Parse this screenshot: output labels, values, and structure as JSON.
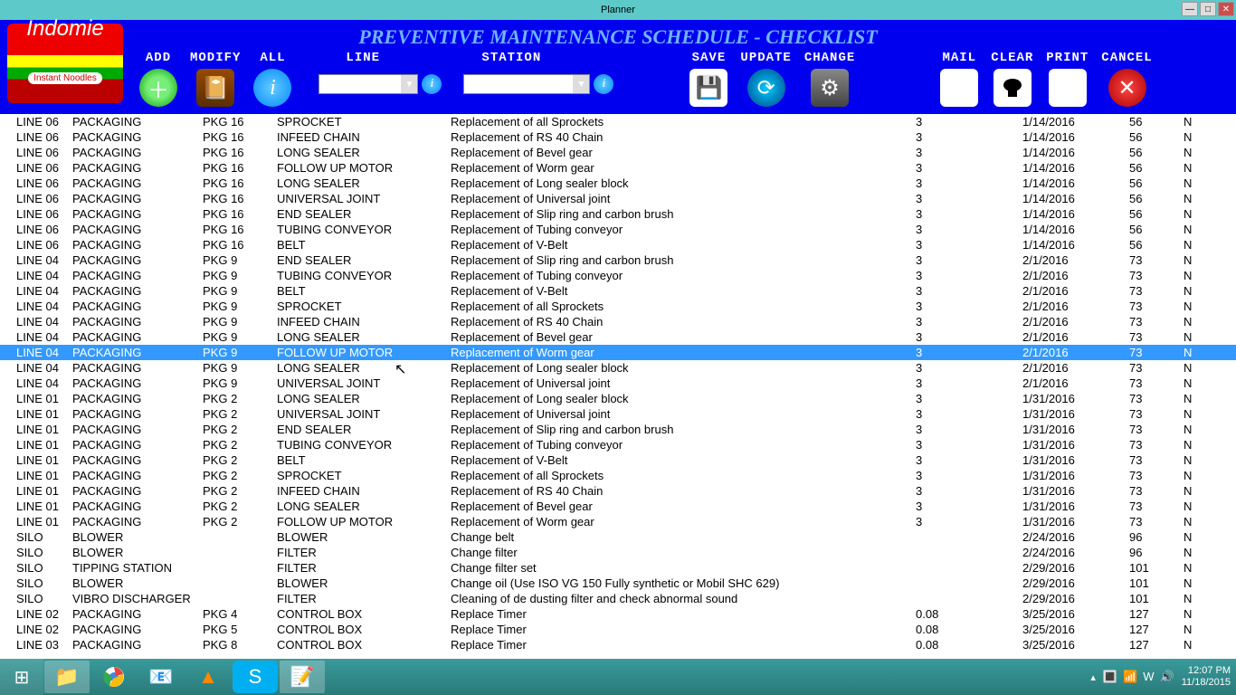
{
  "window": {
    "title": "Planner"
  },
  "toolbar": {
    "title": "PREVENTIVE MAINTENANCE SCHEDULE - CHECKLIST",
    "logo_text": "Indomie",
    "logo_sub": "Instant Noodles",
    "add": "ADD",
    "modify": "MODIFY",
    "all": "ALL",
    "line": "LINE",
    "station": "STATION",
    "save": "SAVE",
    "update": "UPDATE",
    "change": "CHANGE",
    "mail": "MAIL",
    "clear": "CLEAR",
    "print": "PRINT",
    "cancel": "CANCEL"
  },
  "selected_index": 15,
  "rows": [
    {
      "line": "LINE 06",
      "station": "PACKAGING",
      "code": "PKG 16",
      "part": "SPROCKET",
      "desc": "Replacement of all Sprockets",
      "qty": "3",
      "date": "1/14/2016",
      "days": "56",
      "flag": "N"
    },
    {
      "line": "LINE 06",
      "station": "PACKAGING",
      "code": "PKG 16",
      "part": "INFEED CHAIN",
      "desc": "Replacement of RS 40 Chain",
      "qty": "3",
      "date": "1/14/2016",
      "days": "56",
      "flag": "N"
    },
    {
      "line": "LINE 06",
      "station": "PACKAGING",
      "code": "PKG 16",
      "part": "LONG SEALER",
      "desc": "Replacement of Bevel gear",
      "qty": "3",
      "date": "1/14/2016",
      "days": "56",
      "flag": "N"
    },
    {
      "line": "LINE 06",
      "station": "PACKAGING",
      "code": "PKG 16",
      "part": "FOLLOW UP MOTOR",
      "desc": "Replacement of Worm gear",
      "qty": "3",
      "date": "1/14/2016",
      "days": "56",
      "flag": "N"
    },
    {
      "line": "LINE 06",
      "station": "PACKAGING",
      "code": "PKG 16",
      "part": "LONG SEALER",
      "desc": "Replacement of Long sealer block",
      "qty": "3",
      "date": "1/14/2016",
      "days": "56",
      "flag": "N"
    },
    {
      "line": "LINE 06",
      "station": "PACKAGING",
      "code": "PKG 16",
      "part": "UNIVERSAL JOINT",
      "desc": "Replacement of Universal joint",
      "qty": "3",
      "date": "1/14/2016",
      "days": "56",
      "flag": "N"
    },
    {
      "line": "LINE 06",
      "station": "PACKAGING",
      "code": "PKG 16",
      "part": "END SEALER",
      "desc": "Replacement of Slip ring and carbon brush",
      "qty": "3",
      "date": "1/14/2016",
      "days": "56",
      "flag": "N"
    },
    {
      "line": "LINE 06",
      "station": "PACKAGING",
      "code": "PKG 16",
      "part": "TUBING CONVEYOR",
      "desc": "Replacement of Tubing conveyor",
      "qty": "3",
      "date": "1/14/2016",
      "days": "56",
      "flag": "N"
    },
    {
      "line": "LINE 06",
      "station": "PACKAGING",
      "code": "PKG 16",
      "part": "BELT",
      "desc": "Replacement of V-Belt",
      "qty": "3",
      "date": "1/14/2016",
      "days": "56",
      "flag": "N"
    },
    {
      "line": "LINE 04",
      "station": "PACKAGING",
      "code": "PKG 9",
      "part": "END SEALER",
      "desc": "Replacement of Slip ring and carbon brush",
      "qty": "3",
      "date": "2/1/2016",
      "days": "73",
      "flag": "N"
    },
    {
      "line": "LINE 04",
      "station": "PACKAGING",
      "code": "PKG 9",
      "part": "TUBING CONVEYOR",
      "desc": "Replacement of Tubing conveyor",
      "qty": "3",
      "date": "2/1/2016",
      "days": "73",
      "flag": "N"
    },
    {
      "line": "LINE 04",
      "station": "PACKAGING",
      "code": "PKG 9",
      "part": "BELT",
      "desc": "Replacement of V-Belt",
      "qty": "3",
      "date": "2/1/2016",
      "days": "73",
      "flag": "N"
    },
    {
      "line": "LINE 04",
      "station": "PACKAGING",
      "code": "PKG 9",
      "part": "SPROCKET",
      "desc": "Replacement of all Sprockets",
      "qty": "3",
      "date": "2/1/2016",
      "days": "73",
      "flag": "N"
    },
    {
      "line": "LINE 04",
      "station": "PACKAGING",
      "code": "PKG 9",
      "part": "INFEED CHAIN",
      "desc": "Replacement of RS 40 Chain",
      "qty": "3",
      "date": "2/1/2016",
      "days": "73",
      "flag": "N"
    },
    {
      "line": "LINE 04",
      "station": "PACKAGING",
      "code": "PKG 9",
      "part": "LONG SEALER",
      "desc": "Replacement of Bevel gear",
      "qty": "3",
      "date": "2/1/2016",
      "days": "73",
      "flag": "N"
    },
    {
      "line": "LINE 04",
      "station": "PACKAGING",
      "code": "PKG 9",
      "part": "FOLLOW UP MOTOR",
      "desc": "Replacement of Worm gear",
      "qty": "3",
      "date": "2/1/2016",
      "days": "73",
      "flag": "N"
    },
    {
      "line": "LINE 04",
      "station": "PACKAGING",
      "code": "PKG 9",
      "part": "LONG SEALER",
      "desc": "Replacement of Long sealer block",
      "qty": "3",
      "date": "2/1/2016",
      "days": "73",
      "flag": "N"
    },
    {
      "line": "LINE 04",
      "station": "PACKAGING",
      "code": "PKG 9",
      "part": "UNIVERSAL JOINT",
      "desc": "Replacement of Universal joint",
      "qty": "3",
      "date": "2/1/2016",
      "days": "73",
      "flag": "N"
    },
    {
      "line": "LINE 01",
      "station": "PACKAGING",
      "code": "PKG 2",
      "part": "LONG SEALER",
      "desc": "Replacement of Long sealer block",
      "qty": "3",
      "date": "1/31/2016",
      "days": "73",
      "flag": "N"
    },
    {
      "line": "LINE 01",
      "station": "PACKAGING",
      "code": "PKG 2",
      "part": "UNIVERSAL JOINT",
      "desc": "Replacement of Universal joint",
      "qty": "3",
      "date": "1/31/2016",
      "days": "73",
      "flag": "N"
    },
    {
      "line": "LINE 01",
      "station": "PACKAGING",
      "code": "PKG 2",
      "part": "END SEALER",
      "desc": "Replacement of Slip ring and carbon brush",
      "qty": "3",
      "date": "1/31/2016",
      "days": "73",
      "flag": "N"
    },
    {
      "line": "LINE 01",
      "station": "PACKAGING",
      "code": "PKG 2",
      "part": "TUBING CONVEYOR",
      "desc": "Replacement of Tubing conveyor",
      "qty": "3",
      "date": "1/31/2016",
      "days": "73",
      "flag": "N"
    },
    {
      "line": "LINE 01",
      "station": "PACKAGING",
      "code": "PKG 2",
      "part": "BELT",
      "desc": "Replacement of V-Belt",
      "qty": "3",
      "date": "1/31/2016",
      "days": "73",
      "flag": "N"
    },
    {
      "line": "LINE 01",
      "station": "PACKAGING",
      "code": "PKG 2",
      "part": "SPROCKET",
      "desc": "Replacement of all Sprockets",
      "qty": "3",
      "date": "1/31/2016",
      "days": "73",
      "flag": "N"
    },
    {
      "line": "LINE 01",
      "station": "PACKAGING",
      "code": "PKG 2",
      "part": "INFEED CHAIN",
      "desc": "Replacement of RS 40 Chain",
      "qty": "3",
      "date": "1/31/2016",
      "days": "73",
      "flag": "N"
    },
    {
      "line": "LINE 01",
      "station": "PACKAGING",
      "code": "PKG 2",
      "part": "LONG SEALER",
      "desc": "Replacement of Bevel gear",
      "qty": "3",
      "date": "1/31/2016",
      "days": "73",
      "flag": "N"
    },
    {
      "line": "LINE 01",
      "station": "PACKAGING",
      "code": "PKG 2",
      "part": "FOLLOW UP MOTOR",
      "desc": "Replacement of Worm gear",
      "qty": "3",
      "date": "1/31/2016",
      "days": "73",
      "flag": "N"
    },
    {
      "line": "SILO",
      "station": "BLOWER",
      "code": "",
      "part": "BLOWER",
      "desc": "Change belt",
      "qty": "",
      "date": "2/24/2016",
      "days": "96",
      "flag": "N"
    },
    {
      "line": "SILO",
      "station": "BLOWER",
      "code": "",
      "part": "FILTER",
      "desc": "Change filter",
      "qty": "",
      "date": "2/24/2016",
      "days": "96",
      "flag": "N"
    },
    {
      "line": "SILO",
      "station": "TIPPING STATION",
      "code": "",
      "part": "FILTER",
      "desc": "Change filter set",
      "qty": "",
      "date": "2/29/2016",
      "days": "101",
      "flag": "N"
    },
    {
      "line": "SILO",
      "station": "BLOWER",
      "code": "",
      "part": "BLOWER",
      "desc": "Change oil (Use ISO VG 150 Fully synthetic or Mobil SHC 629)",
      "qty": "",
      "date": "2/29/2016",
      "days": "101",
      "flag": "N"
    },
    {
      "line": "SILO",
      "station": "VIBRO DISCHARGER",
      "code": "",
      "part": "FILTER",
      "desc": "Cleaning of de dusting filter and check abnormal sound",
      "qty": "",
      "date": "2/29/2016",
      "days": "101",
      "flag": "N"
    },
    {
      "line": "LINE 02",
      "station": "PACKAGING",
      "code": "PKG 4",
      "part": "CONTROL BOX",
      "desc": "Replace Timer",
      "qty": "0.08",
      "date": "3/25/2016",
      "days": "127",
      "flag": "N"
    },
    {
      "line": "LINE 02",
      "station": "PACKAGING",
      "code": "PKG 5",
      "part": "CONTROL BOX",
      "desc": "Replace Timer",
      "qty": "0.08",
      "date": "3/25/2016",
      "days": "127",
      "flag": "N"
    },
    {
      "line": "LINE 03",
      "station": "PACKAGING",
      "code": "PKG 8",
      "part": "CONTROL BOX",
      "desc": "Replace Timer",
      "qty": "0.08",
      "date": "3/25/2016",
      "days": "127",
      "flag": "N"
    }
  ],
  "taskbar": {
    "time": "12:07 PM",
    "date": "11/18/2015"
  }
}
